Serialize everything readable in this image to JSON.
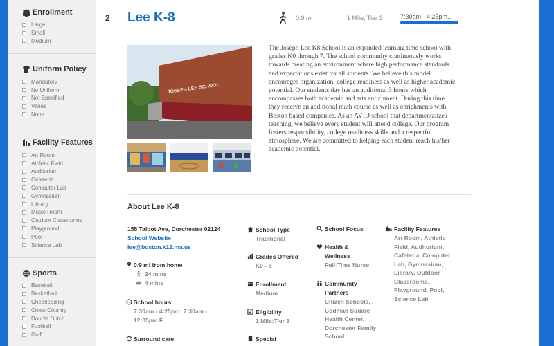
{
  "sidebar": {
    "groups": [
      {
        "title": "Enrollment",
        "icon": "people-icon",
        "options": [
          "Large",
          "Small",
          "Medium"
        ]
      },
      {
        "title": "Uniform Policy",
        "icon": "shirt-icon",
        "options": [
          "Mandatory",
          "No Uniform",
          "Not Specified",
          "Varies",
          "None"
        ]
      },
      {
        "title": "Facility Features",
        "icon": "building-icon",
        "options": [
          "Art Room",
          "Athletic Field",
          "Auditorium",
          "Cafeteria",
          "Computer Lab",
          "Gymnasium",
          "Library",
          "Music Room",
          "Outdoor Classrooms",
          "Playground",
          "Pool",
          "Science Lab"
        ]
      },
      {
        "title": "Sports",
        "icon": "ball-icon",
        "options": [
          "Baseball",
          "Basketball",
          "Cheerleading",
          "Cross Country",
          "Double Dutch",
          "Football",
          "Golf"
        ]
      }
    ]
  },
  "school": {
    "number": "2",
    "name": "Lee K-8",
    "distance": "0.9 mi",
    "tier": "1 Mile, Tier 3",
    "hours_tab": "7:30am - 4:25pm...",
    "photo_sign": "JOSEPH LEE SCHOOL",
    "description": "The Joseph Lee K8 School is an expanded learning time school with grades K0 through 7. The school community continuously works towards creating an environment where high performance standards and expectations exist for all students. We believe this model encourages organization, college readiness as well as higher academic potential. Our students day has an additional 3 hours which encompasses both academic and arts enrichment. During this time they receive an additional math course as well as enrichments with Boston based companies. As an AVID school that departmentalizes teaching, we believe every student will attend college. Our program fosters responsibility, college readiness skills and a respectful atmosphere. We are committed to helping each student reach his/her academic potential."
  },
  "about": {
    "title": "About Lee K-8",
    "address": "155 Talbot Ave, Dorchester 02124",
    "website": "School Website",
    "email": "lee@boston.k12.ma.us",
    "distance_label": "0.9 mi from home",
    "walk_time": "24 mins",
    "drive_time": "4 mins",
    "hours_label": "School hours",
    "hours_value": "7:30am - 4:25pm; 7:30am - 12:05pm F",
    "surround_label": "Surround care",
    "school_type_label": "School Type",
    "school_type_value": "Traditional",
    "grades_label": "Grades Offered",
    "grades_value": "K0 - 8",
    "enrollment_label": "Enrollment",
    "enrollment_value": "Medium",
    "eligibility_label": "Eligibility",
    "eligibility_value": "1 Mile:Tier 3",
    "special_label": "Special",
    "focus_label": "School Focus",
    "health_label": "Health & Wellness",
    "health_value": "Full-Time Nurse",
    "community_label": "Community Partners",
    "community_value": "Citizen Schools, , Codman Square Health Center, Dorchester Family School",
    "facility_label": "Facility Features",
    "facility_value": "Art Room, Athletic Field, Auditorium, Cafeteria, Computer Lab, Gymnasium, Library, Outdoor Classrooms, Playground, Pool, Science Lab"
  },
  "colors": {
    "accent": "#1a6fd6",
    "link": "#1a6fbf"
  }
}
